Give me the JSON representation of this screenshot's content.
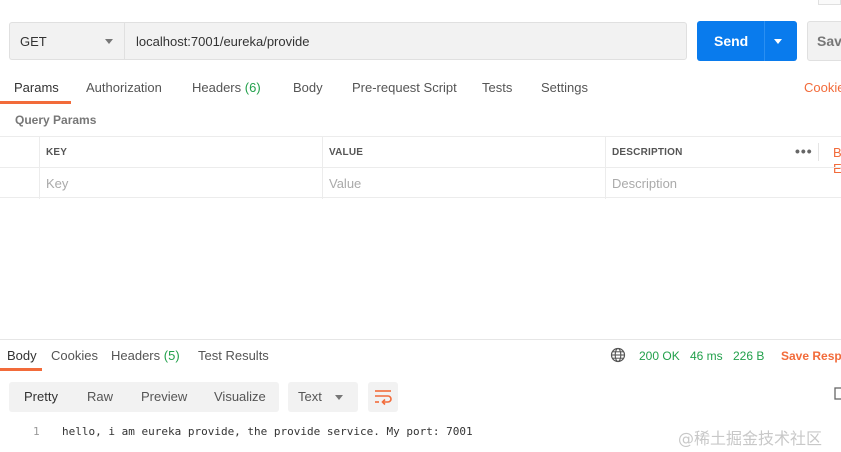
{
  "request": {
    "method": "GET",
    "url": "localhost:7001/eureka/provide",
    "send_label": "Send",
    "save_label": "Save"
  },
  "request_tabs": [
    {
      "label": "Params",
      "active": true
    },
    {
      "label": "Authorization"
    },
    {
      "label": "Headers",
      "count": "(6)"
    },
    {
      "label": "Body"
    },
    {
      "label": "Pre-request Script"
    },
    {
      "label": "Tests"
    },
    {
      "label": "Settings"
    }
  ],
  "cookies_label": "Cookies",
  "query_params": {
    "title": "Query Params",
    "headers": [
      "KEY",
      "VALUE",
      "DESCRIPTION"
    ],
    "placeholders": [
      "Key",
      "Value",
      "Description"
    ],
    "bulk_edit_label": "Bulk Edit"
  },
  "response": {
    "tabs": [
      {
        "label": "Body",
        "active": true
      },
      {
        "label": "Cookies"
      },
      {
        "label": "Headers",
        "count": "(5)"
      },
      {
        "label": "Test Results"
      }
    ],
    "status": "200 OK",
    "time": "46 ms",
    "size": "226 B",
    "save_label": "Save Response",
    "formats": [
      "Pretty",
      "Raw",
      "Preview",
      "Visualize"
    ],
    "active_format": "Pretty",
    "language": "Text",
    "lines": [
      {
        "number": "1",
        "text": "hello, i am eureka provide, the provide service. My port: 7001"
      }
    ]
  },
  "watermark": "@稀土掘金技术社区",
  "colors": {
    "accent": "#f26b3a",
    "send": "#097bed",
    "success": "#22a04b"
  }
}
